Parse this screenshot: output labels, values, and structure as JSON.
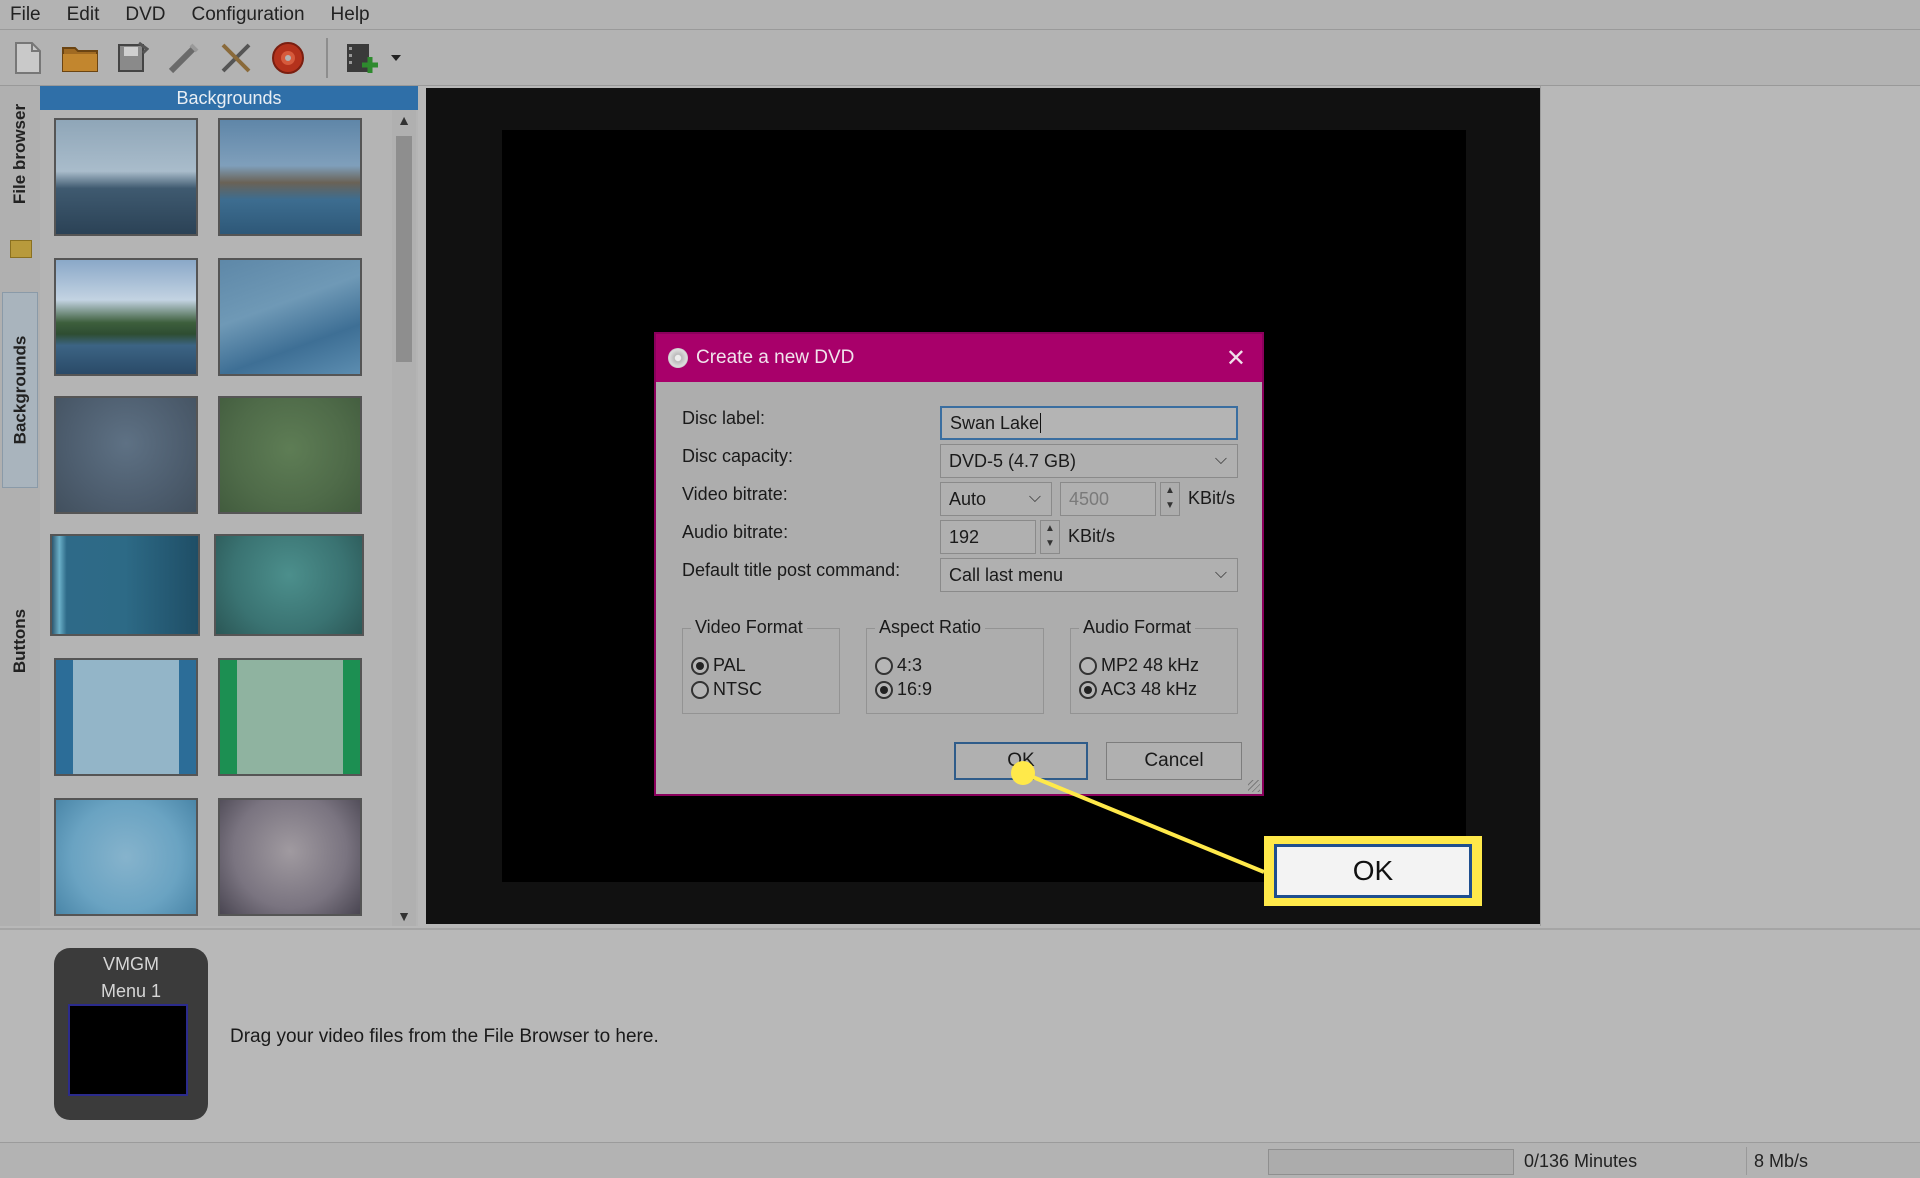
{
  "menubar": {
    "items": [
      "File",
      "Edit",
      "DVD",
      "Configuration",
      "Help"
    ]
  },
  "toolbar": {
    "icons": [
      "new-file-icon",
      "open-folder-icon",
      "save-icon",
      "burn-wand-icon",
      "settings-tools-icon",
      "burn-disc-icon",
      "add-video-icon",
      "dropdown-arrow-icon"
    ]
  },
  "side_tabs": {
    "file_browser": "File browser",
    "backgrounds": "Backgrounds",
    "buttons": "Buttons"
  },
  "backgrounds_panel": {
    "header": "Backgrounds"
  },
  "dialog": {
    "title": "Create a new DVD",
    "disc_label_label": "Disc label:",
    "disc_label_value": "Swan Lake",
    "disc_capacity_label": "Disc capacity:",
    "disc_capacity_value": "DVD-5 (4.7 GB)",
    "video_bitrate_label": "Video bitrate:",
    "video_bitrate_mode": "Auto",
    "video_bitrate_value": "4500",
    "video_bitrate_unit": "KBit/s",
    "audio_bitrate_label": "Audio bitrate:",
    "audio_bitrate_value": "192",
    "audio_bitrate_unit": "KBit/s",
    "post_command_label": "Default title post command:",
    "post_command_value": "Call last menu",
    "video_format": {
      "title": "Video Format",
      "options": [
        "PAL",
        "NTSC"
      ],
      "selected": "PAL"
    },
    "aspect_ratio": {
      "title": "Aspect Ratio",
      "options": [
        "4:3",
        "16:9"
      ],
      "selected": "16:9"
    },
    "audio_format": {
      "title": "Audio Format",
      "options": [
        "MP2 48 kHz",
        "AC3 48 kHz"
      ],
      "selected": "AC3 48 kHz"
    },
    "ok_label": "OK",
    "cancel_label": "Cancel"
  },
  "callout": {
    "label": "OK",
    "color": "#ffe94a"
  },
  "menus_area": {
    "vmgm_label": "VMGM",
    "menu1_label": "Menu 1",
    "hint": "Drag your video files from the File Browser to here."
  },
  "statusbar": {
    "duration": "0/136 Minutes",
    "bitrate": "8 Mb/s"
  },
  "colors": {
    "title_bar": "#a8006a",
    "accent_blue": "#2f6fa8"
  }
}
